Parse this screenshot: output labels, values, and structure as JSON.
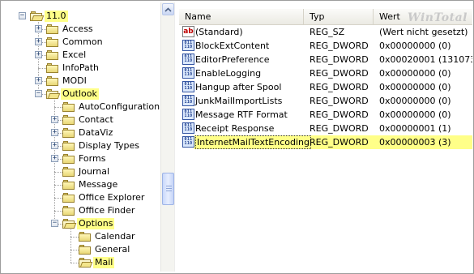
{
  "tree": {
    "nodes": [
      {
        "label": "11.0",
        "expander": "−",
        "state": "open",
        "highlight": true
      },
      {
        "label": "Access",
        "expander": "+",
        "state": "closed",
        "highlight": false
      },
      {
        "label": "Common",
        "expander": "+",
        "state": "closed",
        "highlight": false
      },
      {
        "label": "Excel",
        "expander": "+",
        "state": "closed",
        "highlight": false
      },
      {
        "label": "InfoPath",
        "expander": "",
        "state": "closed",
        "highlight": false
      },
      {
        "label": "MODI",
        "expander": "+",
        "state": "closed",
        "highlight": false
      },
      {
        "label": "Outlook",
        "expander": "−",
        "state": "open",
        "highlight": true
      },
      {
        "label": "AutoConfiguration",
        "expander": "",
        "state": "closed",
        "highlight": false
      },
      {
        "label": "Contact",
        "expander": "+",
        "state": "closed",
        "highlight": false
      },
      {
        "label": "DataViz",
        "expander": "+",
        "state": "closed",
        "highlight": false
      },
      {
        "label": "Display Types",
        "expander": "+",
        "state": "closed",
        "highlight": false
      },
      {
        "label": "Forms",
        "expander": "+",
        "state": "closed",
        "highlight": false
      },
      {
        "label": "Journal",
        "expander": "",
        "state": "closed",
        "highlight": false
      },
      {
        "label": "Message",
        "expander": "",
        "state": "closed",
        "highlight": false
      },
      {
        "label": "Office Explorer",
        "expander": "",
        "state": "closed",
        "highlight": false
      },
      {
        "label": "Office Finder",
        "expander": "",
        "state": "closed",
        "highlight": false
      },
      {
        "label": "Options",
        "expander": "−",
        "state": "open",
        "highlight": true
      },
      {
        "label": "Calendar",
        "expander": "",
        "state": "closed",
        "highlight": false
      },
      {
        "label": "General",
        "expander": "",
        "state": "closed",
        "highlight": false
      },
      {
        "label": "Mail",
        "expander": "",
        "state": "open",
        "highlight": true
      }
    ]
  },
  "list": {
    "columns": {
      "name": "Name",
      "type": "Typ",
      "value": "Wert"
    },
    "watermark": "WinTotal",
    "rows": [
      {
        "icon": "string-value-icon",
        "name": "(Standard)",
        "type": "REG_SZ",
        "value": "(Wert nicht gesetzt)",
        "highlight": false
      },
      {
        "icon": "dword-value-icon",
        "name": "BlockExtContent",
        "type": "REG_DWORD",
        "value": "0x00000000 (0)",
        "highlight": false
      },
      {
        "icon": "dword-value-icon",
        "name": "EditorPreference",
        "type": "REG_DWORD",
        "value": "0x00020001 (131073)",
        "highlight": false
      },
      {
        "icon": "dword-value-icon",
        "name": "EnableLogging",
        "type": "REG_DWORD",
        "value": "0x00000000 (0)",
        "highlight": false
      },
      {
        "icon": "dword-value-icon",
        "name": "Hangup after Spool",
        "type": "REG_DWORD",
        "value": "0x00000000 (0)",
        "highlight": false
      },
      {
        "icon": "dword-value-icon",
        "name": "JunkMailImportLists",
        "type": "REG_DWORD",
        "value": "0x00000000 (0)",
        "highlight": false
      },
      {
        "icon": "dword-value-icon",
        "name": "Message RTF Format",
        "type": "REG_DWORD",
        "value": "0x00000000 (0)",
        "highlight": false
      },
      {
        "icon": "dword-value-icon",
        "name": "Receipt Response",
        "type": "REG_DWORD",
        "value": "0x00000001 (1)",
        "highlight": false
      },
      {
        "icon": "dword-value-icon",
        "name": "InternetMailTextEncoding",
        "type": "REG_DWORD",
        "value": "0x00000003 (3)",
        "highlight": true
      }
    ]
  },
  "icon_text": {
    "string": "ab",
    "dword": "011"
  },
  "colors": {
    "highlight": "#ffff88",
    "folder": "#e8d777"
  }
}
